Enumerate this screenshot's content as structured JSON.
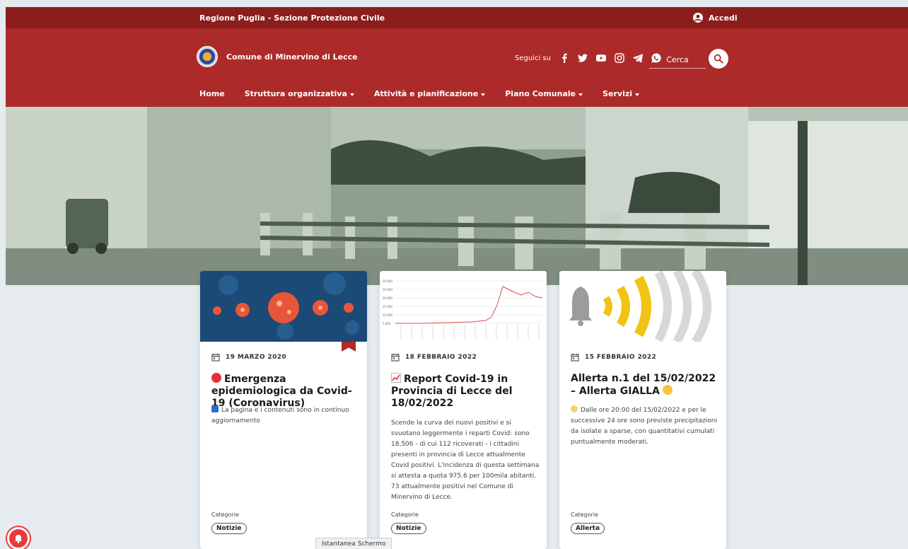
{
  "topbar": {
    "region_link": "Regione Puglia - Sezione Protezione Civile",
    "login_label": "Accedi"
  },
  "header": {
    "site_name": "Comune di Minervino di Lecce",
    "social_label": "Seguici su",
    "social_icons": [
      "facebook-icon",
      "twitter-icon",
      "youtube-icon",
      "instagram-icon",
      "telegram-icon",
      "whatsapp-icon"
    ],
    "search_placeholder": "Cerca"
  },
  "nav": {
    "items": [
      {
        "label": "Home",
        "dropdown": false
      },
      {
        "label": "Struttura organizzativa",
        "dropdown": true
      },
      {
        "label": "Attività e pianificazione",
        "dropdown": true
      },
      {
        "label": "Piano Comunale",
        "dropdown": true
      },
      {
        "label": "Servizi",
        "dropdown": true
      }
    ]
  },
  "cards": [
    {
      "date": "19 MARZO 2020",
      "title": "Emergenza epidemiologica da Covid-19 (Coronavirus)",
      "excerpt": "La pagina e i contenuti sono in continuo aggiornamento",
      "category_label": "Categorie",
      "category": "Notizie"
    },
    {
      "date": "18 FEBBRAIO 2022",
      "title": "Report Covid-19 in Provincia di Lecce del 18/02/2022",
      "excerpt": "Scende la curva dei nuovi positivi e si svuotano leggermente i reparti Covid: sono 18.506 - di cui 112 ricoverati - i cittadini presenti in provincia di Lecce attualmente Covid positivi. L'incidenza di questa settimana si attesta a quota 975.6 per 100mila abitanti. 73 attualmente positivi nel Comune di Minervino di Lecce.",
      "category_label": "Categorie",
      "category": "Notizie"
    },
    {
      "date": "15 FEBBRAIO 2022",
      "title": "Allerta n.1 del 15/02/2022 – Allerta GIALLA",
      "excerpt": "Dalle ore 20:00 del 15/02/2022 e per le successive 24 ore sono previste precipitazioni da isolate a sparse, con quantitativi cumulati puntualmente moderati.",
      "category_label": "Categorie",
      "category": "Allerta"
    }
  ],
  "tooltip": "Istantanea Schermo",
  "colors": {
    "topbar": "#8c1d1d",
    "header": "#ad2a2a",
    "background": "#e6ebef",
    "accent_red": "#b02a2a",
    "alert_yellow": "#f2c314"
  }
}
